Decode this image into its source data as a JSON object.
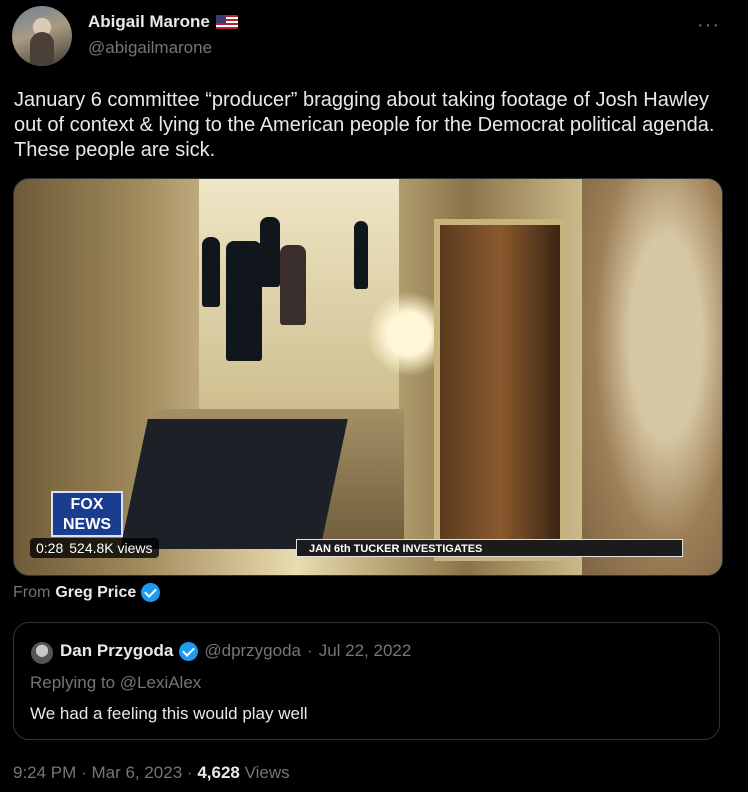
{
  "author": {
    "name": "Abigail Marone",
    "flag_icon": "us-flag-icon",
    "handle": "@abigailmarone"
  },
  "more_icon": "more-horizontal-icon",
  "tweet": {
    "text": "January 6 committee “producer” bragging about taking footage of Josh Hawley out of context & lying to the American people for the Democrat political agenda. These people are sick."
  },
  "media": {
    "logo_text": "FOX NEWS",
    "time": "0:28",
    "views": "524.8K views",
    "ticker": "JAN 6th TUCKER INVESTIGATES"
  },
  "source": {
    "prefix": "From",
    "name": "Greg Price"
  },
  "quote": {
    "name": "Dan Przygoda",
    "handle": "@dprzygoda",
    "separator": "·",
    "date": "Jul 22, 2022",
    "replying_to": "Replying to @LexiAlex",
    "text": "We had a feeling this would play well"
  },
  "footer": {
    "time": "9:24 PM",
    "separator": "·",
    "date": "Mar 6, 2023",
    "views_count": "4,628",
    "views_label": "Views"
  },
  "colors": {
    "background": "#000000",
    "text": "#e7e9ea",
    "muted": "#71767b",
    "verified": "#1d9bf0",
    "border": "#2f3336"
  }
}
